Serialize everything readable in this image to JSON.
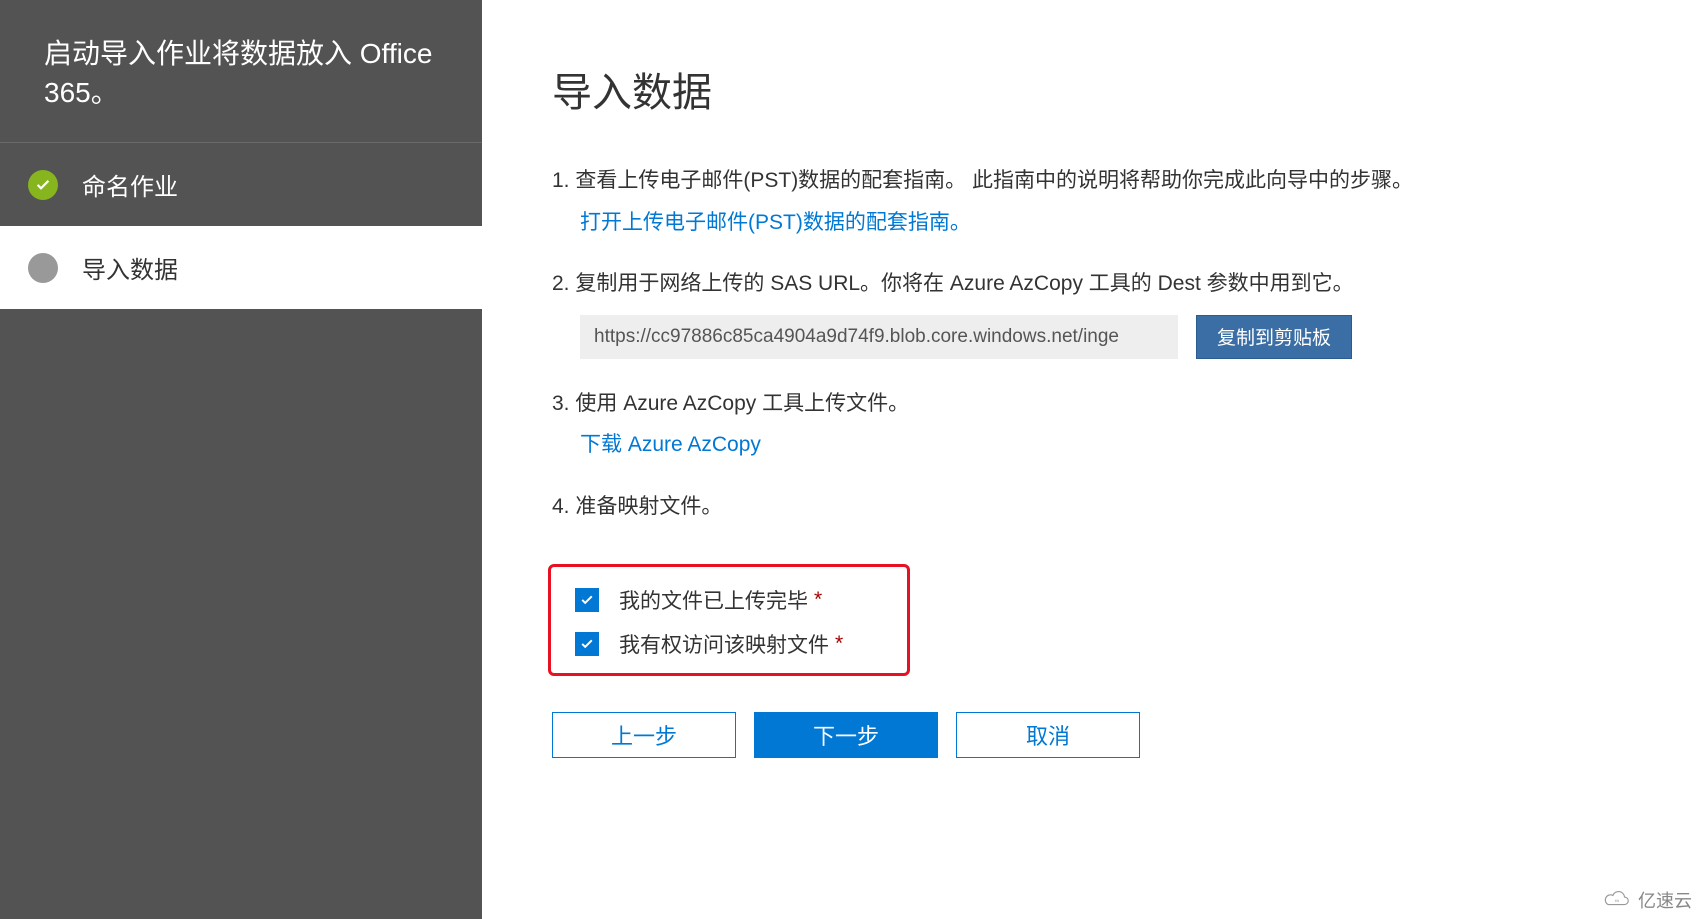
{
  "sidebar": {
    "title": "启动导入作业将数据放入 Office 365。",
    "steps": [
      {
        "label": "命名作业",
        "status": "completed"
      },
      {
        "label": "导入数据",
        "status": "active"
      }
    ]
  },
  "main": {
    "title": "导入数据",
    "items": [
      {
        "num": "1.",
        "text": "查看上传电子邮件(PST)数据的配套指南。 此指南中的说明将帮助你完成此向导中的步骤。",
        "link": "打开上传电子邮件(PST)数据的配套指南。"
      },
      {
        "num": "2.",
        "text": "复制用于网络上传的 SAS URL。你将在 Azure AzCopy 工具的 Dest 参数中用到它。",
        "sas_value": "https://cc97886c85ca4904a9d74f9.blob.core.windows.net/inge",
        "copy_label": "复制到剪贴板"
      },
      {
        "num": "3.",
        "text": "使用 Azure AzCopy 工具上传文件。",
        "link": "下载 Azure AzCopy"
      },
      {
        "num": "4.",
        "text": "准备映射文件。"
      }
    ],
    "checks": [
      {
        "label": "我的文件已上传完毕",
        "required": true,
        "checked": true
      },
      {
        "label": "我有权访问该映射文件",
        "required": true,
        "checked": true
      }
    ],
    "buttons": {
      "prev": "上一步",
      "next": "下一步",
      "cancel": "取消"
    }
  },
  "watermark": {
    "text": "亿速云"
  }
}
